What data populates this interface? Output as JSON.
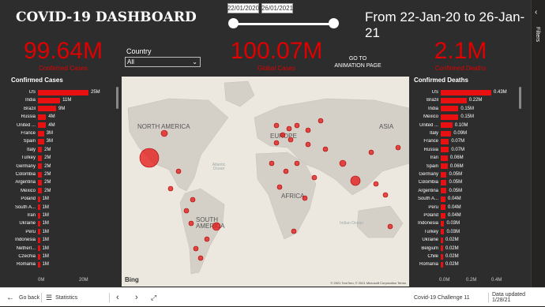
{
  "header": {
    "title": "COVID-19 DASHBOARD",
    "date_start": "22/01/2020",
    "date_end": "26/01/2021",
    "range_text": "From 22-Jan-20 to 26-Jan-21"
  },
  "kpis": [
    {
      "value": "99.64M",
      "label": "Confirmed Cases"
    },
    {
      "value": "100.07M",
      "label": "Global Cases"
    },
    {
      "value": "2.1M",
      "label": "Confirmed Deaths"
    }
  ],
  "country_filter": {
    "label": "Country",
    "value": "All"
  },
  "animation_link": "GO TO ANIMATION PAGE",
  "confirmed_cases": {
    "title": "Confirmed Cases",
    "rows": [
      {
        "country": "US",
        "value": 25,
        "label": "25M"
      },
      {
        "country": "India",
        "value": 11,
        "label": "11M"
      },
      {
        "country": "Brazil",
        "value": 9,
        "label": "9M"
      },
      {
        "country": "Russia",
        "value": 4,
        "label": "4M"
      },
      {
        "country": "United ...",
        "value": 4,
        "label": "4M"
      },
      {
        "country": "France",
        "value": 3,
        "label": "3M"
      },
      {
        "country": "Spain",
        "value": 3,
        "label": "3M"
      },
      {
        "country": "Italy",
        "value": 2,
        "label": "2M"
      },
      {
        "country": "Turkey",
        "value": 2,
        "label": "2M"
      },
      {
        "country": "Germany",
        "value": 2,
        "label": "2M"
      },
      {
        "country": "Colombia",
        "value": 2,
        "label": "2M"
      },
      {
        "country": "Argentina",
        "value": 2,
        "label": "2M"
      },
      {
        "country": "Mexico",
        "value": 2,
        "label": "2M"
      },
      {
        "country": "Poland",
        "value": 1,
        "label": "1M"
      },
      {
        "country": "South A...",
        "value": 1,
        "label": "1M"
      },
      {
        "country": "Iran",
        "value": 1,
        "label": "1M"
      },
      {
        "country": "Ukraine",
        "value": 1,
        "label": "1M"
      },
      {
        "country": "Peru",
        "value": 1,
        "label": "1M"
      },
      {
        "country": "Indonesia",
        "value": 1,
        "label": "1M"
      },
      {
        "country": "Netherl...",
        "value": 1,
        "label": "1M"
      },
      {
        "country": "Czechia",
        "value": 1,
        "label": "1M"
      },
      {
        "country": "Romania",
        "value": 1,
        "label": "1M"
      }
    ],
    "axis_ticks": [
      "0M",
      "20M"
    ]
  },
  "confirmed_deaths": {
    "title": "Confirmed Deaths",
    "rows": [
      {
        "country": "US",
        "value": 0.43,
        "label": "0.43M"
      },
      {
        "country": "Brazil",
        "value": 0.22,
        "label": "0.22M"
      },
      {
        "country": "India",
        "value": 0.15,
        "label": "0.15M"
      },
      {
        "country": "Mexico",
        "value": 0.15,
        "label": "0.15M"
      },
      {
        "country": "United ...",
        "value": 0.1,
        "label": "0.10M"
      },
      {
        "country": "Italy",
        "value": 0.09,
        "label": "0.09M"
      },
      {
        "country": "France",
        "value": 0.07,
        "label": "0.07M"
      },
      {
        "country": "Russia",
        "value": 0.07,
        "label": "0.07M"
      },
      {
        "country": "Iran",
        "value": 0.06,
        "label": "0.06M"
      },
      {
        "country": "Spain",
        "value": 0.06,
        "label": "0.06M"
      },
      {
        "country": "Germany",
        "value": 0.05,
        "label": "0.05M"
      },
      {
        "country": "Colombia",
        "value": 0.05,
        "label": "0.05M"
      },
      {
        "country": "Argentina",
        "value": 0.05,
        "label": "0.05M"
      },
      {
        "country": "South A...",
        "value": 0.04,
        "label": "0.04M"
      },
      {
        "country": "Peru",
        "value": 0.04,
        "label": "0.04M"
      },
      {
        "country": "Poland",
        "value": 0.04,
        "label": "0.04M"
      },
      {
        "country": "Indonesia",
        "value": 0.03,
        "label": "0.03M"
      },
      {
        "country": "Turkey",
        "value": 0.03,
        "label": "0.03M"
      },
      {
        "country": "Ukraine",
        "value": 0.02,
        "label": "0.02M"
      },
      {
        "country": "Belgium",
        "value": 0.02,
        "label": "0.02M"
      },
      {
        "country": "Chile",
        "value": 0.02,
        "label": "0.02M"
      },
      {
        "country": "Romania",
        "value": 0.02,
        "label": "0.02M"
      }
    ],
    "axis_ticks": [
      "0.0M",
      "0.2M",
      "0.4M"
    ]
  },
  "map": {
    "labels": [
      "NORTH AMERICA",
      "EUROPE",
      "ASIA",
      "AFRICA",
      "SOUTH AMERICA"
    ],
    "oceans": [
      "Atlantic Ocean",
      "Indian Ocean"
    ],
    "provider": "Bing",
    "copyright": "© 2021 TomTom, © 2021 Microsoft Corporation Terms"
  },
  "filters_pane": {
    "label": "Filters"
  },
  "bottom_bar": {
    "back": "Go back",
    "page": "Statistics",
    "report_name": "Covid-19 Challenge 11",
    "updated": "Data updated 1/28/21"
  },
  "colors": {
    "accent": "#e00000",
    "bar": "#e81010",
    "background": "#2d2d2d"
  }
}
